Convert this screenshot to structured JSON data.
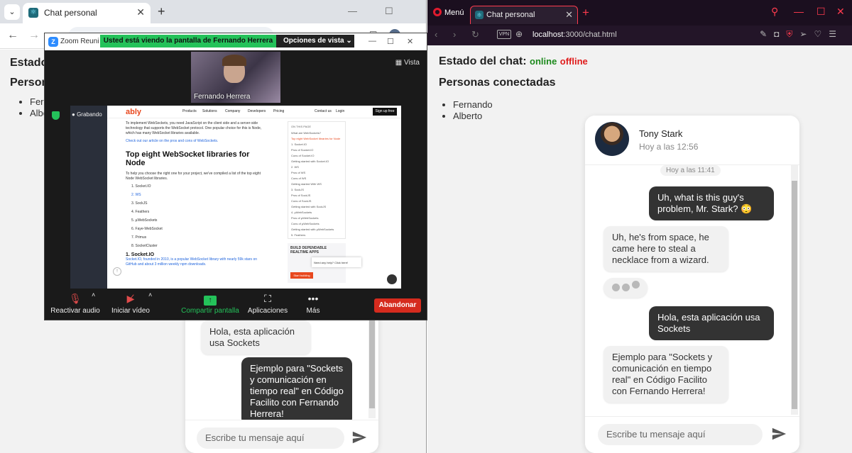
{
  "chrome": {
    "tab_title": "Chat personal",
    "tab_icon": "react-icon",
    "page": {
      "status_heading_partial": "Estado",
      "people_heading_partial": "Persona",
      "people_partial": [
        "Ferna",
        "Albe"
      ]
    },
    "chat": {
      "messages": [
        {
          "dir": "in",
          "text": "Hola, esta aplicación usa Sockets"
        },
        {
          "dir": "out",
          "text": "Ejemplo para \"Sockets y comunicación en tiempo real\" en Código Facilito con Fernando Herrera!"
        }
      ],
      "input_placeholder": "Escribe tu mensaje aquí"
    }
  },
  "zoom": {
    "title": "Zoom Reuni",
    "share_banner": "Usted está viendo la pantalla de Fernando Herrera",
    "view_options": "Opciones de vista",
    "participant_name": "Fernando Herrera",
    "view_label": "Vista",
    "recording_label": "Grabando",
    "shared": {
      "logo": "ably",
      "nav": [
        "Products",
        "Solutions",
        "Company",
        "Developers",
        "Pricing",
        "Contact us",
        "Login"
      ],
      "signup": "Sign up free",
      "para1": "To implement WebSockets, you need JavaScript on the client side and a server-side technology that supports the WebSocket protocol. One popular choice for this is Node, which has many WebSocket libraries available.",
      "link1": "Check out our article on the pros and cons of WebSockets.",
      "heading": "Top eight WebSocket libraries for Node",
      "para2": "To help you choose the right one for your project, we've compiled a list of the top eight Node WebSocket libraries.",
      "libs": [
        "1. Socket.IO",
        "2. WS",
        "3. SockJS",
        "4. Feathers",
        "5. µWebSockets",
        "6. Faye-WebSocket",
        "7. Primus",
        "8. SocketCluster"
      ],
      "subheading": "1. Socket.IO",
      "para3": "Socket.IO, founded in 2010, is a popular WebSocket library with nearly 59k stars on GitHub and about 3 million weekly npm downloads.",
      "toc_title": "ON THIS PAGE",
      "toc": [
        "What are WebSockets?",
        "Top eight WebSocket libraries for Node",
        "1. Socket.IO",
        "Pros of Socket.IO",
        "Cons of Socket.IO",
        "Getting started with Socket.IO",
        "2. WS",
        "Pros of WS",
        "Cons of WS",
        "Getting started With WS",
        "3. SockJS",
        "Pros of SockJS",
        "Cons of SockJS",
        "Getting started with SockJS",
        "4. µWebSockets",
        "Pros of µWebSockets",
        "Cons of µWebSockets",
        "Getting started with µWebSockets",
        "5. Feathers"
      ],
      "promo_title": "BUILD DEPENDABLE REALTIME APPS",
      "promo_button": "Start building",
      "help_text": "Need any help? Click here!"
    },
    "controls": {
      "mute": "Reactivar audio",
      "video": "Iniciar vídeo",
      "share": "Compartir pantalla",
      "apps": "Aplicaciones",
      "more": "Más",
      "leave": "Abandonar"
    }
  },
  "opera": {
    "menu_label": "Menú",
    "tab_title": "Chat personal",
    "vpn_label": "VPN",
    "url_host": "localhost",
    "url_path": ":3000/chat.html",
    "page": {
      "status_label": "Estado del chat:",
      "status_online": "online",
      "status_offline": "offline",
      "people_heading": "Personas conectadas",
      "people": [
        "Fernando",
        "Alberto"
      ]
    },
    "chat": {
      "contact_name": "Tony Stark",
      "contact_time": "Hoy a las 12:56",
      "day_badge": "Hoy a las 11:41",
      "messages": [
        {
          "dir": "out",
          "text": "Uh, what is this guy's problem, Mr. Stark? 😳"
        },
        {
          "dir": "in",
          "text": "Uh, he's from space, he came here to steal a necklace from a wizard."
        },
        {
          "dir": "out",
          "text": "Hola, esta aplicación usa Sockets"
        },
        {
          "dir": "in",
          "text": "Ejemplo para \"Sockets y comunicación en tiempo real\" en Código Facilito con Fernando Herrera!"
        }
      ],
      "input_placeholder": "Escribe tu mensaje aquí"
    }
  },
  "colors": {
    "online": "#1d8a1d",
    "offline": "#e01b1b",
    "bubble_out": "#333333",
    "bubble_in": "#f1f1f1",
    "zoom_share_green": "#24c25a",
    "zoom_leave_red": "#d52b1e",
    "opera_red": "#ff3b4e"
  }
}
